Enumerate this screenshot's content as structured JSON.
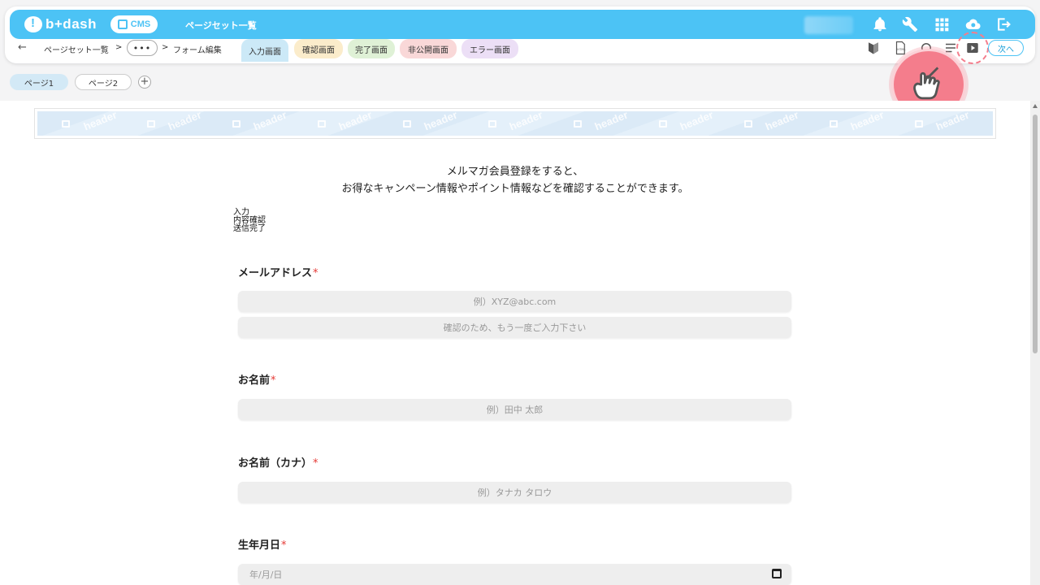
{
  "header": {
    "logo_text": "b+dash",
    "cms_label": "CMS",
    "title": "ページセット一覧"
  },
  "breadcrumb": {
    "back_icon": "←",
    "item1": "ページセット一覧",
    "sep": ">",
    "more": "•••",
    "item2": "フォーム編集"
  },
  "tabs": [
    {
      "label": "入力画面",
      "color": "#cce9f7"
    },
    {
      "label": "確認画面",
      "color": "#fbeccb"
    },
    {
      "label": "完了画面",
      "color": "#dff1d6"
    },
    {
      "label": "非公開画面",
      "color": "#f9d8d8"
    },
    {
      "label": "エラー画面",
      "color": "#ecdff6"
    }
  ],
  "toolbar": {
    "next_label": "次へ"
  },
  "pages": {
    "page1": "ページ1",
    "page2": "ページ2",
    "add": "+"
  },
  "canvas": {
    "header_watermark": "header",
    "intro_line1": "メルマガ会員登録をすると、",
    "intro_line2": "お得なキャンペーン情報やポイント情報などを確認することができます。",
    "steps": [
      "入力",
      "内容確認",
      "送信完了"
    ]
  },
  "form": {
    "email_label": "メールアドレス",
    "required_mark": "*",
    "email_placeholder": "例）XYZ@abc.com",
    "email_confirm_placeholder": "確認のため、もう一度ご入力下さい",
    "name_label": "お名前",
    "name_placeholder": "例）田中 太郎",
    "kana_label": "お名前（カナ）",
    "kana_placeholder": "例）タナカ タロウ",
    "birth_label": "生年月日",
    "birth_placeholder": "年/月/日"
  }
}
